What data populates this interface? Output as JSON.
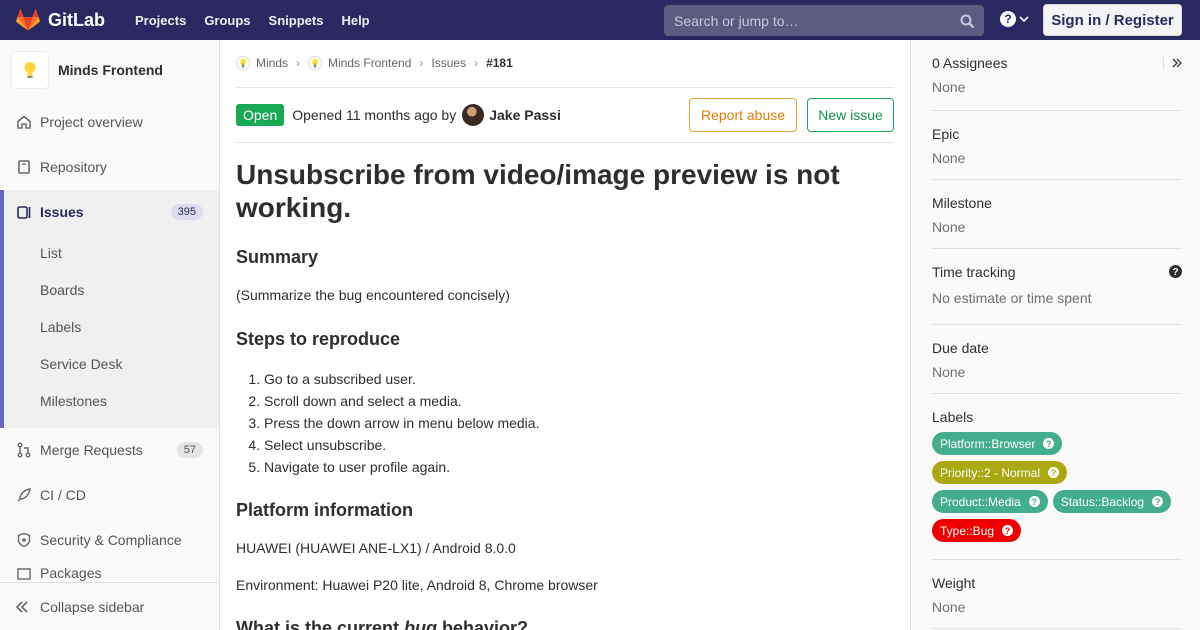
{
  "navbar": {
    "brand": "GitLab",
    "links": [
      "Projects",
      "Groups",
      "Snippets",
      "Help"
    ],
    "search_placeholder": "Search or jump to…",
    "signin_label": "Sign in / Register",
    "bg_color": "#292961"
  },
  "sidebar": {
    "project_name": "Minds Frontend",
    "items": {
      "overview": "Project overview",
      "repository": "Repository",
      "issues": "Issues",
      "issues_count": "395",
      "merge_requests": "Merge Requests",
      "mr_count": "57",
      "cicd": "CI / CD",
      "security": "Security & Compliance",
      "partial": "Packages"
    },
    "issue_subitems": [
      "List",
      "Boards",
      "Labels",
      "Service Desk",
      "Milestones"
    ],
    "collapse_label": "Collapse sidebar"
  },
  "breadcrumb": {
    "group": "Minds",
    "project": "Minds Frontend",
    "section": "Issues",
    "issue": "#181"
  },
  "issue": {
    "status": "Open",
    "opened_text": "Opened 11 months ago by",
    "author": "Jake Passi",
    "report_abuse": "Report abuse",
    "new_issue": "New issue",
    "title": "Unsubscribe from video/image preview is not working.",
    "summary_heading": "Summary",
    "summary_text": "(Summarize the bug encountered concisely)",
    "steps_heading": "Steps to reproduce",
    "steps": [
      "Go to a subscribed user.",
      "Scroll down and select a media.",
      "Press the down arrow in menu below media.",
      "Select unsubscribe.",
      "Navigate to user profile again."
    ],
    "platform_heading": "Platform information",
    "platform_text": "HUAWEI (HUAWEI ANE-LX1) / Android 8.0.0",
    "environment_text": "Environment: Huawei P20 lite, Android 8, Chrome browser",
    "current_heading_pre": "What is the current ",
    "current_heading_em": "bug",
    "current_heading_post": " behavior?"
  },
  "right_sidebar": {
    "assignees_title": "0 Assignees",
    "assignees_value": "None",
    "epic_title": "Epic",
    "epic_value": "None",
    "milestone_title": "Milestone",
    "milestone_value": "None",
    "time_title": "Time tracking",
    "time_value": "No estimate or time spent",
    "due_title": "Due date",
    "due_value": "None",
    "labels_title": "Labels",
    "labels": [
      {
        "text": "Platform::Browser",
        "color": "#44ad8e"
      },
      {
        "text": "Priority::2 - Normal",
        "color": "#aaa912"
      },
      {
        "text": "Product::Media",
        "color": "#44ad8e"
      },
      {
        "text": "Status::Backlog",
        "color": "#44ad8e"
      },
      {
        "text": "Type::Bug",
        "color": "#ee0000"
      }
    ],
    "weight_title": "Weight",
    "weight_value": "None"
  }
}
